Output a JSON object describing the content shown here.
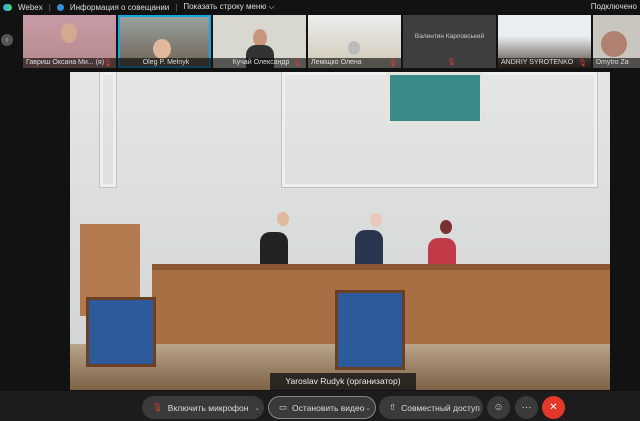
{
  "topbar": {
    "app": "Webex",
    "meeting_info": "Информация о совещании",
    "show_menu": "Показать строку меню ⌵",
    "status": "Подключено"
  },
  "participants": [
    {
      "name": "Гавриш Оксана Ми...",
      "tag": "(я)",
      "muted": true
    },
    {
      "name": "Oleg P. Melnyk",
      "muted": false,
      "active": true
    },
    {
      "name": "Кучай Олександр",
      "muted": true
    },
    {
      "name": "Леміщко Олена",
      "muted": true
    },
    {
      "name": "Валентин Карповський",
      "muted": true,
      "no_video": true
    },
    {
      "name": "ANDRIY SYROTENKO",
      "muted": true
    },
    {
      "name": "Dmytro Za",
      "muted": false
    }
  ],
  "speaker": {
    "caption": "Yaroslav Rudyk (организатор)"
  },
  "controls": {
    "mic": "Включить микрофон",
    "video": "Остановить видео",
    "share": "Совместный доступ",
    "reactions": "☺",
    "more": "···",
    "leave": "✕"
  },
  "colors": {
    "accent": "#19a6e0",
    "leave": "#e4392a",
    "muted": "#e23c2a"
  }
}
